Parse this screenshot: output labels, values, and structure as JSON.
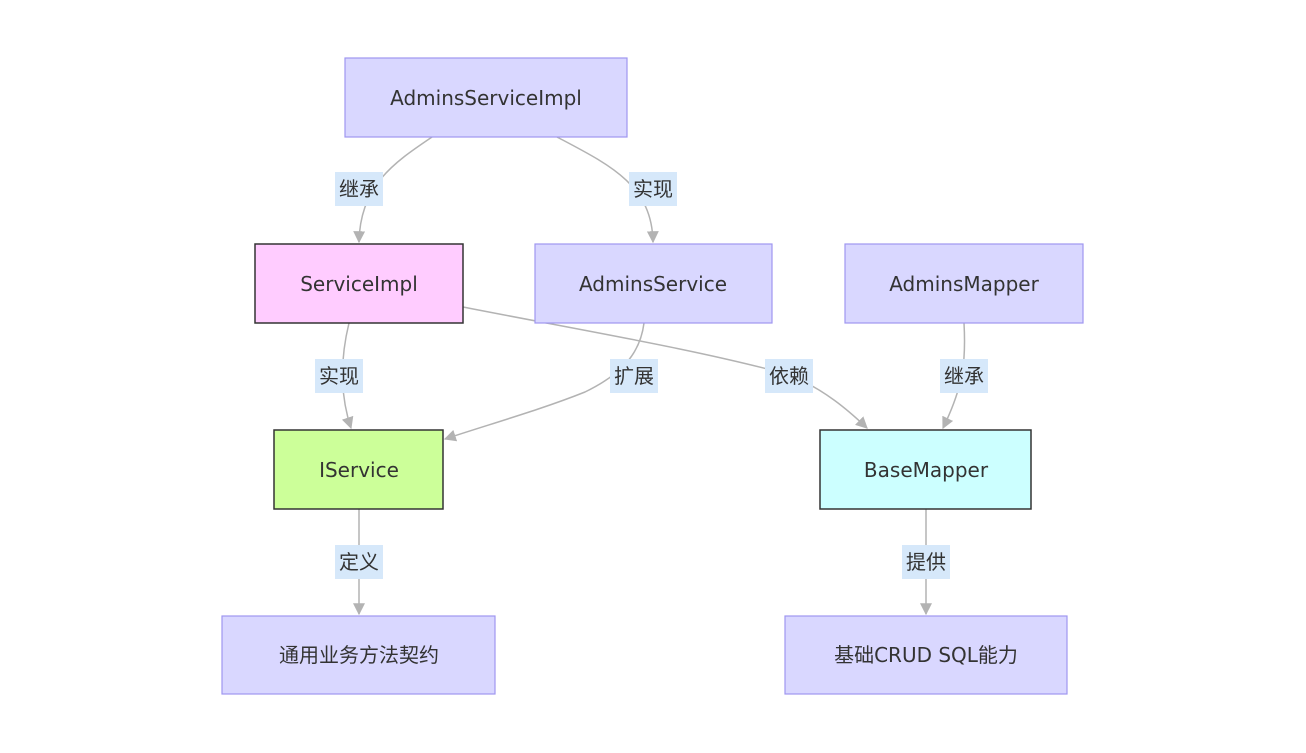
{
  "diagram": {
    "nodes": {
      "admins_service_impl": {
        "label": "AdminsServiceImpl",
        "fill": "#d9d7ff",
        "stroke": "#9f97f0"
      },
      "service_impl": {
        "label": "ServiceImpl",
        "fill": "#ffccff",
        "stroke": "#333333"
      },
      "admins_service": {
        "label": "AdminsService",
        "fill": "#d9d7ff",
        "stroke": "#9f97f0"
      },
      "admins_mapper": {
        "label": "AdminsMapper",
        "fill": "#d9d7ff",
        "stroke": "#9f97f0"
      },
      "iservice": {
        "label": "IService",
        "fill": "#ccff99",
        "stroke": "#333333"
      },
      "base_mapper": {
        "label": "BaseMapper",
        "fill": "#ccffff",
        "stroke": "#333333"
      },
      "service_contract": {
        "label": "通用业务方法契约",
        "fill": "#d9d7ff",
        "stroke": "#9f97f0"
      },
      "crud_capability": {
        "label": "基础CRUD SQL能力",
        "fill": "#d9d7ff",
        "stroke": "#9f97f0"
      }
    },
    "edges": {
      "impl_to_serviceimpl": {
        "from": "AdminsServiceImpl",
        "to": "ServiceImpl",
        "label": "继承"
      },
      "impl_to_adminsservice": {
        "from": "AdminsServiceImpl",
        "to": "AdminsService",
        "label": "实现"
      },
      "serviceimpl_to_iservice": {
        "from": "ServiceImpl",
        "to": "IService",
        "label": "实现"
      },
      "adminsservice_to_iservice": {
        "from": "AdminsService",
        "to": "IService",
        "label": "扩展"
      },
      "serviceimpl_to_basemapper": {
        "from": "ServiceImpl",
        "to": "BaseMapper",
        "label": "依赖"
      },
      "adminsmapper_to_basemapper": {
        "from": "AdminsMapper",
        "to": "BaseMapper",
        "label": "继承"
      },
      "iservice_to_contract": {
        "from": "IService",
        "to": "通用业务方法契约",
        "label": "定义"
      },
      "basemapper_to_crud": {
        "from": "BaseMapper",
        "to": "基础CRUD SQL能力",
        "label": "提供"
      }
    },
    "colors": {
      "edge": "#b3b3b3",
      "edge_label_bg": "#d6e8fa",
      "text": "#333333"
    }
  }
}
